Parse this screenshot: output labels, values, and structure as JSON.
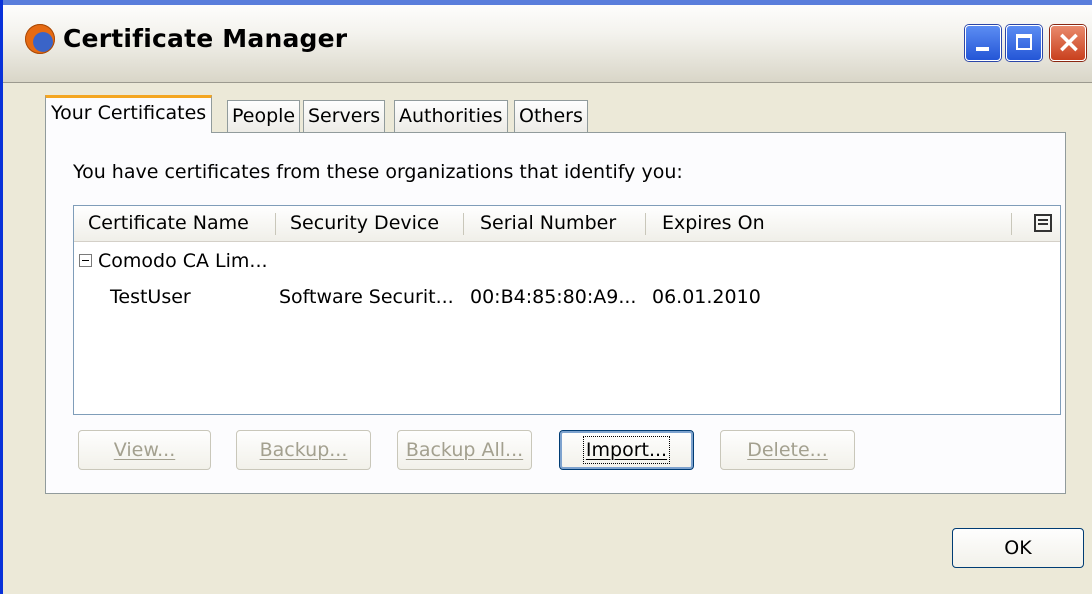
{
  "window": {
    "title": "Certificate Manager",
    "icon": "firefox-icon",
    "controls": {
      "minimize": "minimize-icon",
      "maximize": "maximize-icon",
      "close": "×"
    }
  },
  "tabs": [
    {
      "label": "Your Certificates",
      "active": true
    },
    {
      "label": "People",
      "active": false
    },
    {
      "label": "Servers",
      "active": false
    },
    {
      "label": "Authorities",
      "active": false
    },
    {
      "label": "Others",
      "active": false
    }
  ],
  "panel": {
    "intro": "You have certificates from these organizations that identify you:",
    "columns": [
      "Certificate Name",
      "Security Device",
      "Serial Number",
      "Expires On"
    ],
    "column_picker_icon": "column-picker-icon",
    "groups": [
      {
        "name": "Comodo CA Lim...",
        "expanded": true,
        "rows": [
          {
            "name": "TestUser",
            "device": "Software Securit...",
            "serial": "00:B4:85:80:A9...",
            "expires": "06.01.2010"
          }
        ]
      }
    ]
  },
  "buttons": {
    "view": "View...",
    "backup": "Backup...",
    "backup_all": "Backup All...",
    "import": "Import...",
    "delete": "Delete..."
  },
  "ok_label": "OK",
  "colors": {
    "title_bar_accent": "#5a7edc",
    "active_tab_accent": "#f4a622",
    "dialog_bg": "#ece9d8"
  }
}
